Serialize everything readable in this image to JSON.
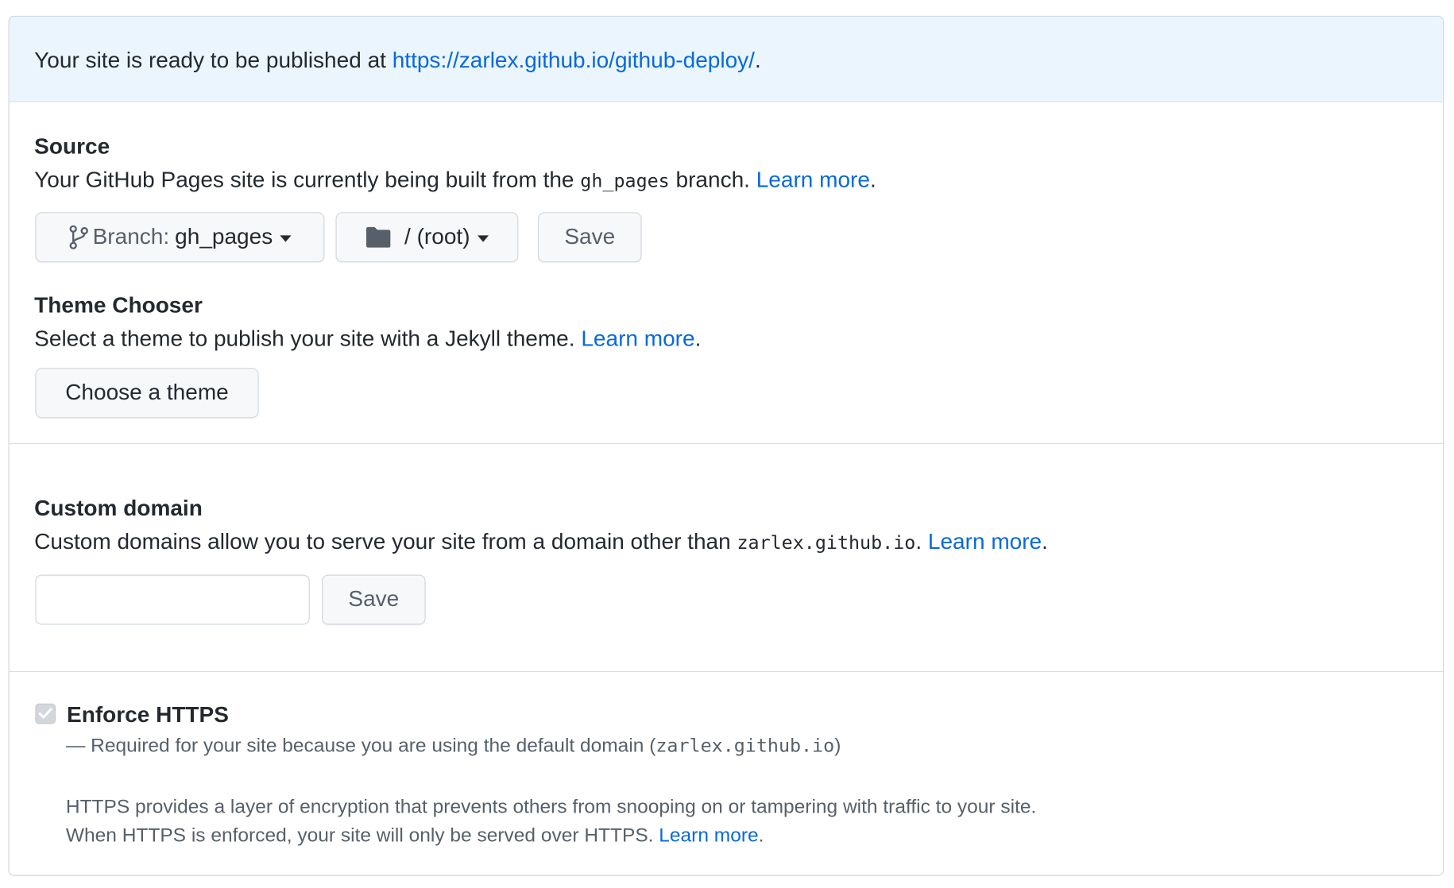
{
  "banner": {
    "prefix": "Your site is ready to be published at ",
    "url": "https://zarlex.github.io/github-deploy/",
    "suffix": "."
  },
  "source": {
    "heading": "Source",
    "desc_prefix": "Your GitHub Pages site is currently being built from the ",
    "branch_code": "gh_pages",
    "desc_suffix": " branch. ",
    "learn_more": "Learn more",
    "period": ".",
    "branch_button_prefix": "Branch: ",
    "branch_button_value": "gh_pages",
    "folder_button_label": "/ (root)",
    "save_label": "Save"
  },
  "theme": {
    "heading": "Theme Chooser",
    "desc": "Select a theme to publish your site with a Jekyll theme. ",
    "learn_more": "Learn more",
    "period": ".",
    "button_label": "Choose a theme"
  },
  "custom_domain": {
    "heading": "Custom domain",
    "desc_prefix": "Custom domains allow you to serve your site from a domain other than ",
    "domain_code": "zarlex.github.io",
    "desc_suffix": ". ",
    "learn_more": "Learn more",
    "period": ".",
    "input_value": "",
    "input_placeholder": "",
    "save_label": "Save"
  },
  "https": {
    "label": "Enforce HTTPS",
    "checked": true,
    "note_prefix": "— Required for your site because you are using the default domain (",
    "note_code": "zarlex.github.io",
    "note_suffix": ")",
    "desc_line1": "HTTPS provides a layer of encryption that prevents others from snooping on or tampering with traffic to your site.",
    "desc_line2": "When HTTPS is enforced, your site will only be served over HTTPS. ",
    "learn_more": "Learn more",
    "period": "."
  },
  "colors": {
    "link": "#0969da",
    "banner_bg": "#eaf5fe",
    "border": "#d0d7de",
    "text": "#24292f",
    "muted_text": "#57606a",
    "button_bg": "#f6f8fa"
  },
  "icons": {
    "branch": "git-branch-icon",
    "folder": "folder-icon",
    "caret": "triangle-down-icon",
    "check": "check-icon"
  }
}
